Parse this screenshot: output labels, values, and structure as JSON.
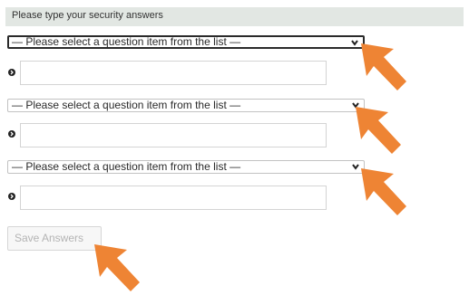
{
  "header": {
    "title": "Please type your security answers"
  },
  "questions": [
    {
      "select_value": "— Please select a question item from the list —",
      "answer_value": "",
      "focused": true
    },
    {
      "select_value": "— Please select a question item from the list —",
      "answer_value": "",
      "focused": false
    },
    {
      "select_value": "— Please select a question item from the list —",
      "answer_value": "",
      "focused": false
    }
  ],
  "save_button": {
    "label": "Save Answers",
    "disabled": true
  },
  "icons": {
    "bullet": "circle-chevron-right-icon",
    "dropdown": "chevron-down-icon",
    "pointer": "cursor-arrow-icon"
  },
  "colors": {
    "header_bg": "#e2e7e3",
    "arrow_orange": "#ee8434",
    "focused_border": "#2a2a2a",
    "disabled_text": "#b4b4b4"
  }
}
